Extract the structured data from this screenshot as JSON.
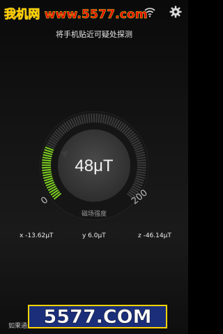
{
  "watermark": {
    "top_text": "我机网 www.5577.com",
    "bottom_text": "5577.COM"
  },
  "header": {
    "instruction": "将手机贴近可疑处探测"
  },
  "gauge": {
    "reading": "48μT",
    "value": 48,
    "min_label": "0",
    "max_label": "200",
    "label": "磁场强度",
    "active_color": "#7ed321",
    "track_color": "#3a3a3a"
  },
  "axes": {
    "x": "x -13.62μT",
    "y": "y 6.0μT",
    "z": "z -46.14μT"
  },
  "footer": {
    "hint": "如果通过镜头发现可疑物品，请使用摄像头"
  },
  "icons": {
    "wifi": "wifi-icon",
    "settings": "gear-icon"
  }
}
